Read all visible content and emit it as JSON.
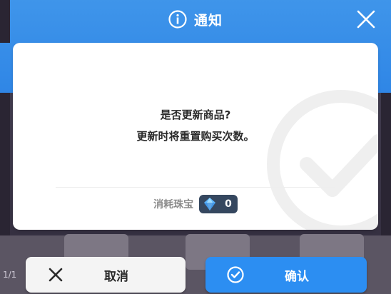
{
  "dialog": {
    "title": "通知",
    "title_icon": "info-icon",
    "close_icon": "close-icon",
    "message_line1": "是否更新商品?",
    "message_line2": "更新时将重置购买次数。",
    "cost_label": "消耗珠宝",
    "cost_icon": "gem-icon",
    "cost_value": "0"
  },
  "buttons": {
    "cancel_label": "取消",
    "confirm_label": "确认"
  },
  "background": {
    "count_text": "1/1"
  },
  "colors": {
    "header_blue": "#2f86e6",
    "confirm_blue": "#2c8ef2",
    "cost_pill": "#35475f"
  }
}
